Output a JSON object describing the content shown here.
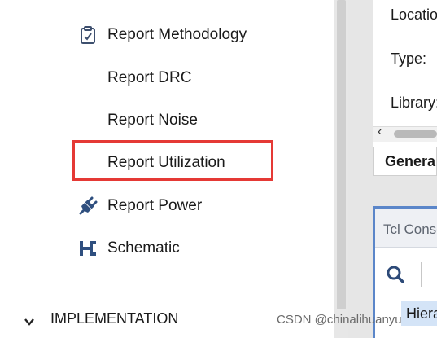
{
  "flow_nav": {
    "items": [
      {
        "label": "Report Methodology",
        "icon": "clipboard-check-icon"
      },
      {
        "label": "Report DRC",
        "icon": ""
      },
      {
        "label": "Report Noise",
        "icon": ""
      },
      {
        "label": "Report Utilization",
        "icon": "",
        "highlighted": true
      },
      {
        "label": "Report Power",
        "icon": "power-plug-icon"
      },
      {
        "label": "Schematic",
        "icon": "schematic-icon"
      }
    ],
    "section": {
      "label": "IMPLEMENTATION",
      "icon": "chevron-down-icon"
    }
  },
  "properties": {
    "rows": [
      "Location:",
      "Type:",
      "Library:"
    ],
    "general_tab": "General"
  },
  "tcl_console": {
    "title": "Tcl Console",
    "hier_label": "Hierarchy"
  },
  "watermark": "CSDN @chinalihuanyu",
  "colors": {
    "highlight": "#e53935",
    "tcl_border": "#5b86c9"
  }
}
